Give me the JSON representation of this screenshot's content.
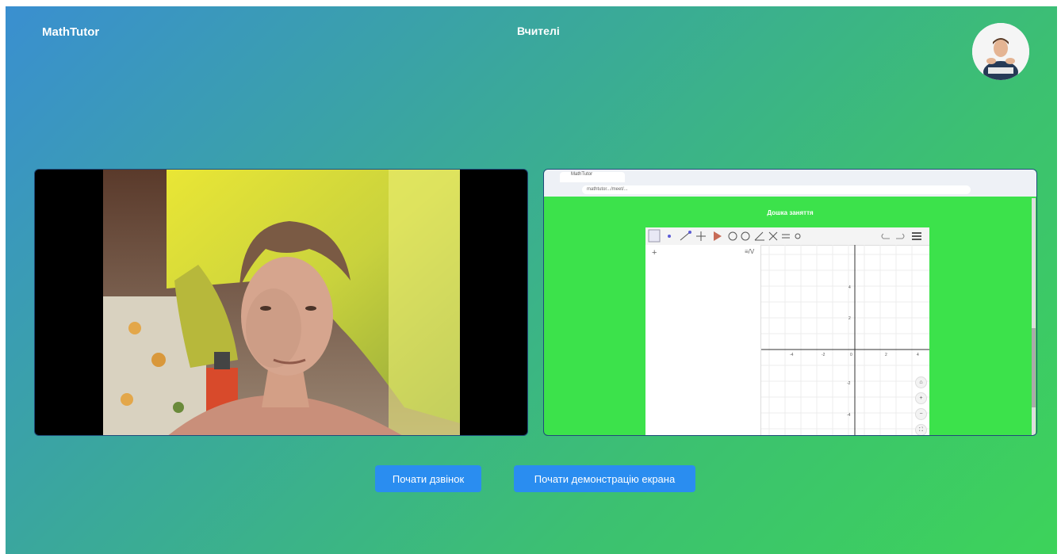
{
  "brand": "MathTutor",
  "nav": {
    "teachers_label": "Вчителі"
  },
  "screen_share": {
    "browser_tab": "MathTutor",
    "address": "mathtutor.../meet/...",
    "board_title": "Дошка заняття",
    "algebra_plus": "+",
    "algebra_menu": "≡/V",
    "axis_labels": {
      "x": [
        "-4",
        "-2",
        "0",
        "2",
        "4"
      ],
      "y": [
        "4",
        "2",
        "-2",
        "-4"
      ]
    }
  },
  "controls": {
    "start_call": "Почати дзвінок",
    "start_screen_share": "Почати демонстрацію екрана"
  },
  "colors": {
    "accent": "#2a8df0",
    "gradient_start": "#3a8fd0",
    "gradient_end": "#3dd35a"
  }
}
